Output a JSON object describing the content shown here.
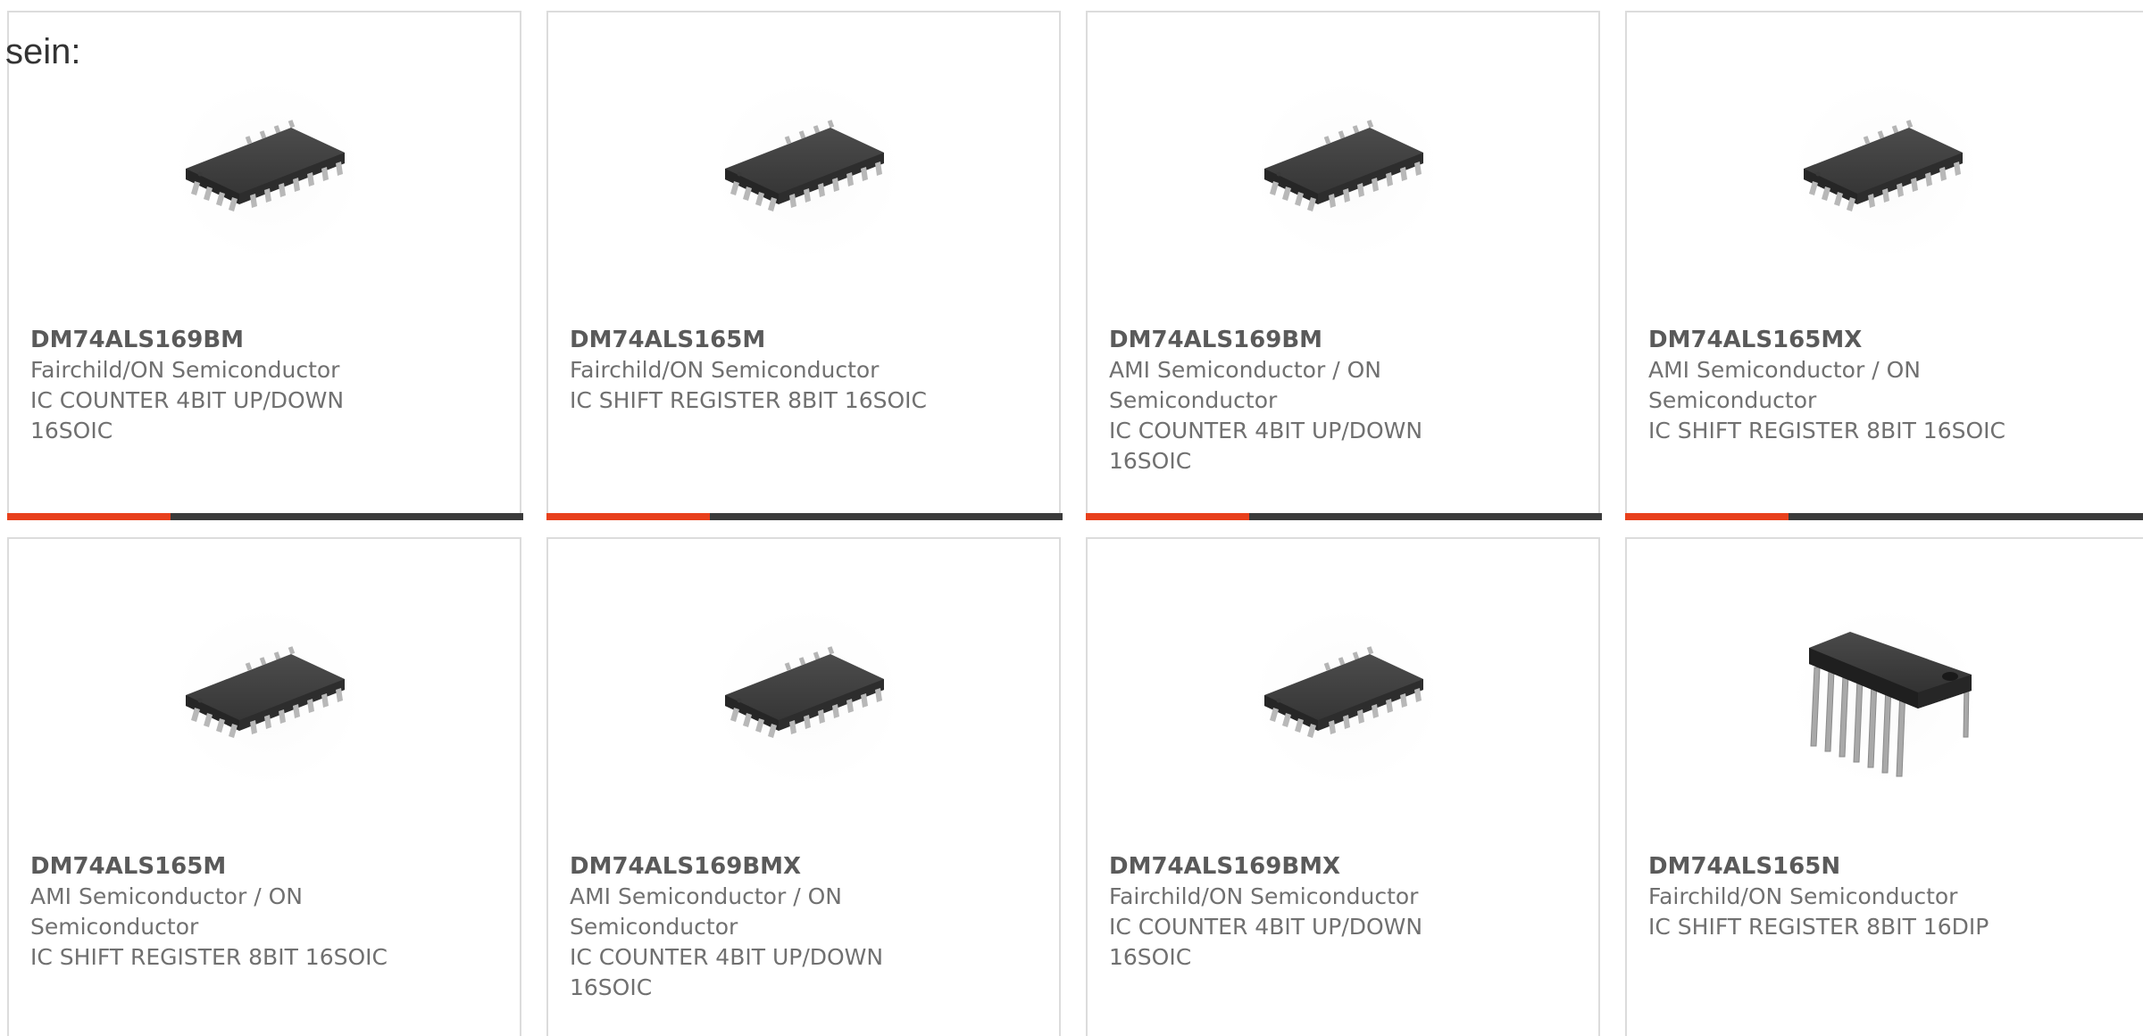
{
  "intro_text": "sein:",
  "colors": {
    "accent": "#e8401c",
    "bar": "#3b3b3b",
    "border": "#dcdcdc",
    "text": "#707070"
  },
  "cards": [
    {
      "part": "DM74ALS169BM",
      "manufacturer": "Fairchild/ON Semiconductor",
      "description": "IC COUNTER 4BIT UP/DOWN 16SOIC",
      "image": "soic-chip-image"
    },
    {
      "part": "DM74ALS165M",
      "manufacturer": "Fairchild/ON Semiconductor",
      "description": "IC SHIFT REGISTER 8BIT 16SOIC",
      "image": "soic-chip-image"
    },
    {
      "part": "DM74ALS169BM",
      "manufacturer": "AMI Semiconductor / ON Semiconductor",
      "description": "IC COUNTER 4BIT UP/DOWN 16SOIC",
      "image": "soic-chip-image"
    },
    {
      "part": "DM74ALS165MX",
      "manufacturer": "AMI Semiconductor / ON Semiconductor",
      "description": "IC SHIFT REGISTER 8BIT 16SOIC",
      "image": "soic-chip-image"
    },
    {
      "part": "DM74ALS165M",
      "manufacturer": "AMI Semiconductor / ON Semiconductor",
      "description": "IC SHIFT REGISTER 8BIT 16SOIC",
      "image": "soic-chip-image"
    },
    {
      "part": "DM74ALS169BMX",
      "manufacturer": "AMI Semiconductor / ON Semiconductor",
      "description": "IC COUNTER 4BIT UP/DOWN 16SOIC",
      "image": "soic-chip-image"
    },
    {
      "part": "DM74ALS169BMX",
      "manufacturer": "Fairchild/ON Semiconductor",
      "description": "IC COUNTER 4BIT UP/DOWN 16SOIC",
      "image": "soic-chip-image"
    },
    {
      "part": "DM74ALS165N",
      "manufacturer": "Fairchild/ON Semiconductor",
      "description": "IC SHIFT REGISTER 8BIT 16DIP",
      "image": "dip-chip-image"
    }
  ]
}
